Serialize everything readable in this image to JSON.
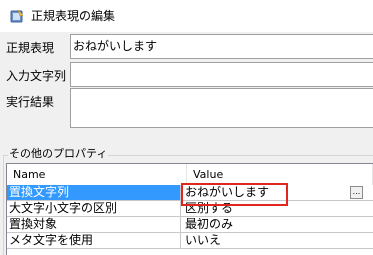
{
  "window": {
    "title": "正規表現の編集",
    "icon": "app-icon"
  },
  "fields": [
    {
      "label": "正規表現",
      "value": "おねがいします"
    },
    {
      "label": "入力文字列",
      "value": ""
    },
    {
      "label": "実行結果",
      "value": ""
    }
  ],
  "properties": {
    "group_label": "その他のプロパティ",
    "columns": {
      "name": "Name",
      "value": "Value"
    },
    "rows": [
      {
        "name": "置換文字列",
        "value": "おねがいします",
        "selected": true,
        "has_button": true,
        "button_label": "..."
      },
      {
        "name": "大文字小文字の区別",
        "value": "区別する"
      },
      {
        "name": "置換対象",
        "value": "最初のみ"
      },
      {
        "name": "メタ文字を使用",
        "value": "いいえ"
      }
    ]
  },
  "colors": {
    "selection": "#3399ff",
    "highlight": "#e0261f"
  }
}
